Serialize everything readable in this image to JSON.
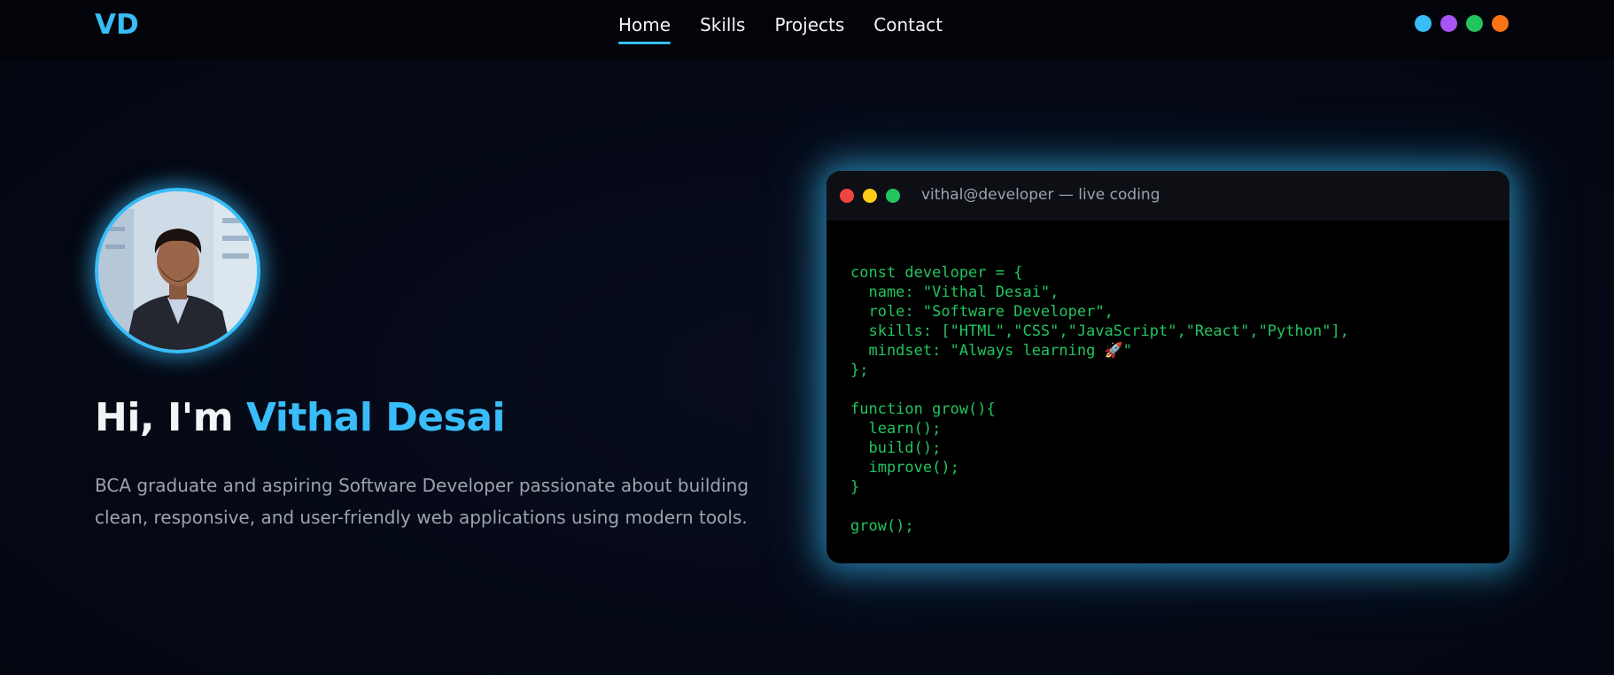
{
  "nav": {
    "logo": "VD",
    "links": [
      {
        "label": "Home",
        "active": true
      },
      {
        "label": "Skills",
        "active": false
      },
      {
        "label": "Projects",
        "active": false
      },
      {
        "label": "Contact",
        "active": false
      }
    ],
    "theme_colors": [
      "#38bdf8",
      "#a855f7",
      "#22c55e",
      "#f97316"
    ]
  },
  "hero": {
    "greeting": "Hi, I'm ",
    "name": "Vithal Desai",
    "description": "BCA graduate and aspiring Software Developer passionate about building clean, responsive, and user-friendly web applications using modern tools.",
    "avatar_icon": "profile-photo"
  },
  "terminal": {
    "title": "vithal@developer — live coding",
    "window_dot_colors": [
      "#ef4444",
      "#facc15",
      "#22c55e"
    ],
    "code": "const developer = {\n  name: \"Vithal Desai\",\n  role: \"Software Developer\",\n  skills: [\"HTML\",\"CSS\",\"JavaScript\",\"React\",\"Python\"],\n  mindset: \"Always learning 🚀\"\n};\n\nfunction grow(){\n  learn();\n  build();\n  improve();\n}\n\ngrow();"
  },
  "colors": {
    "accent": "#38bdf8",
    "code_green": "#22c55e",
    "background": "#050916"
  }
}
